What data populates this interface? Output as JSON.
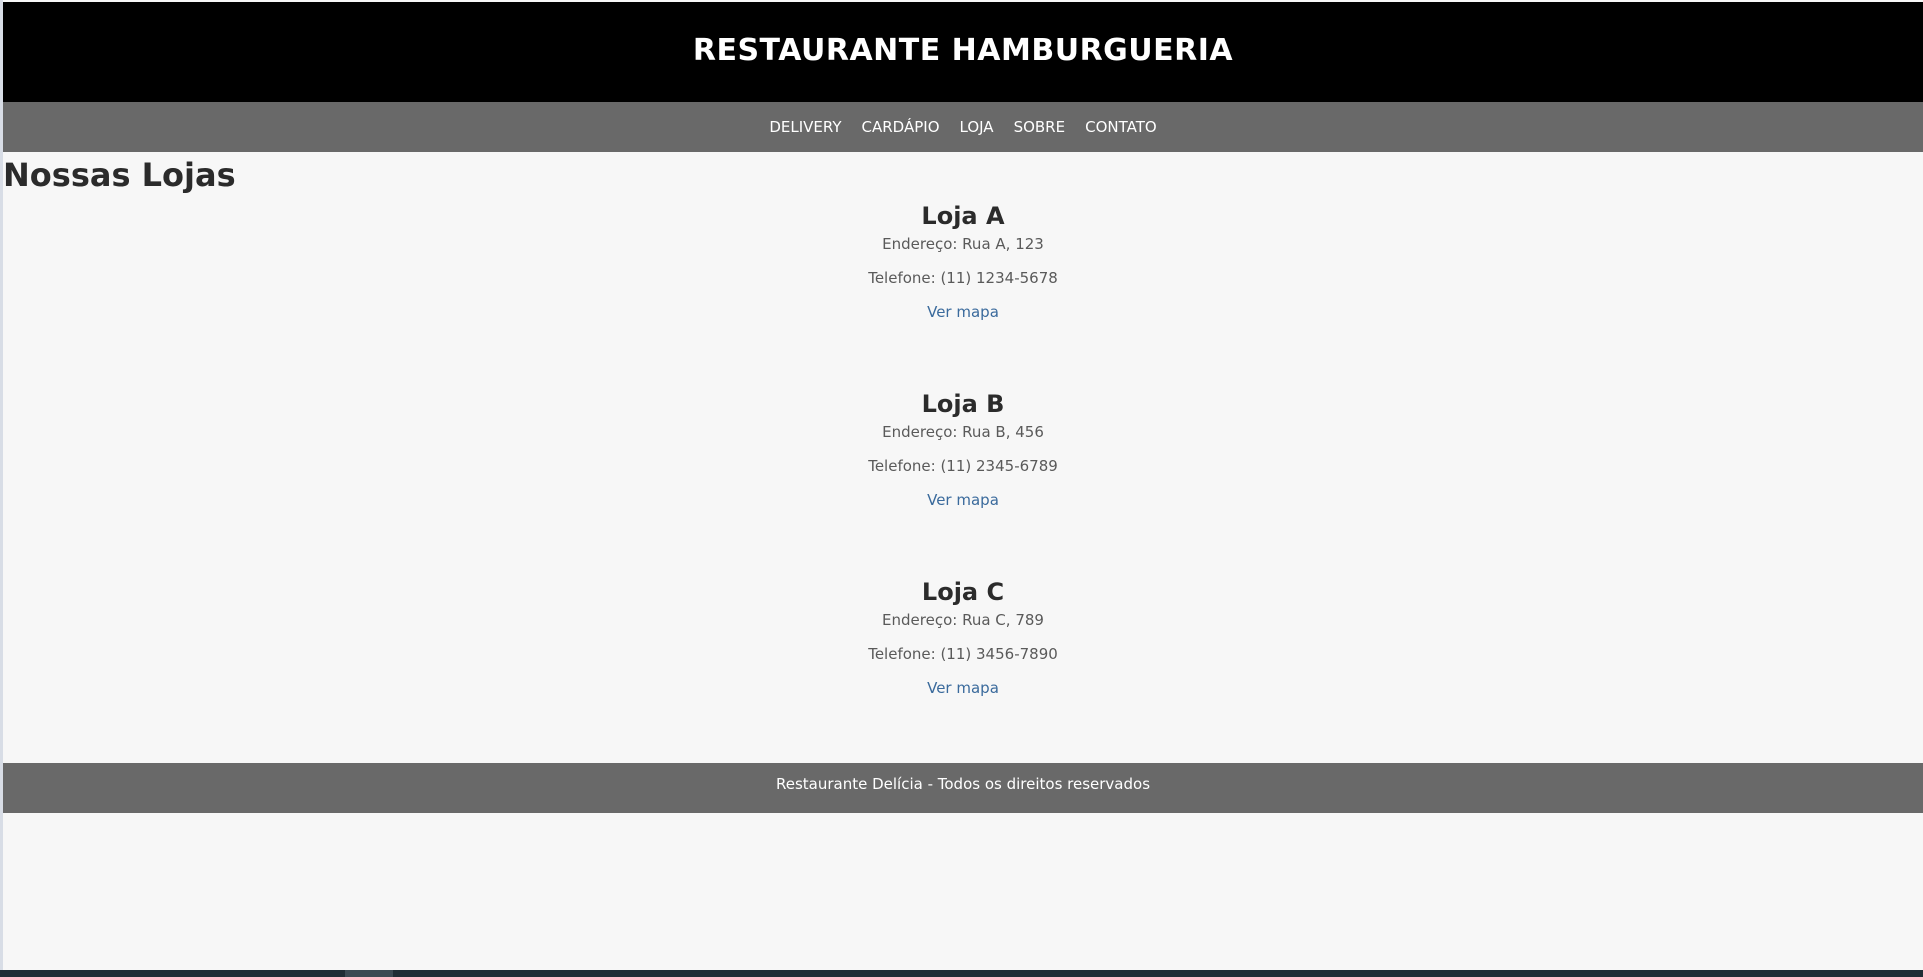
{
  "header": {
    "title": "RESTAURANTE HAMBURGUERIA"
  },
  "nav": {
    "items": [
      {
        "label": "DELIVERY"
      },
      {
        "label": "CARDÁPIO"
      },
      {
        "label": "LOJA"
      },
      {
        "label": "SOBRE"
      },
      {
        "label": "CONTATO"
      }
    ]
  },
  "main": {
    "section_title": "Nossas Lojas",
    "stores": [
      {
        "name": "Loja A",
        "address": "Endereço: Rua A, 123",
        "phone": "Telefone: (11) 1234-5678",
        "map_link": "Ver mapa"
      },
      {
        "name": "Loja B",
        "address": "Endereço: Rua B, 456",
        "phone": "Telefone: (11) 2345-6789",
        "map_link": "Ver mapa"
      },
      {
        "name": "Loja C",
        "address": "Endereço: Rua C, 789",
        "phone": "Telefone: (11) 3456-7890",
        "map_link": "Ver mapa"
      }
    ]
  },
  "footer": {
    "text": "Restaurante Delícia - Todos os direitos reservados"
  },
  "colors": {
    "header_bg": "#000000",
    "nav_bg": "#696969",
    "page_bg": "#f7f7f7",
    "link": "#3a6a9c",
    "footer_bg": "#696969"
  }
}
